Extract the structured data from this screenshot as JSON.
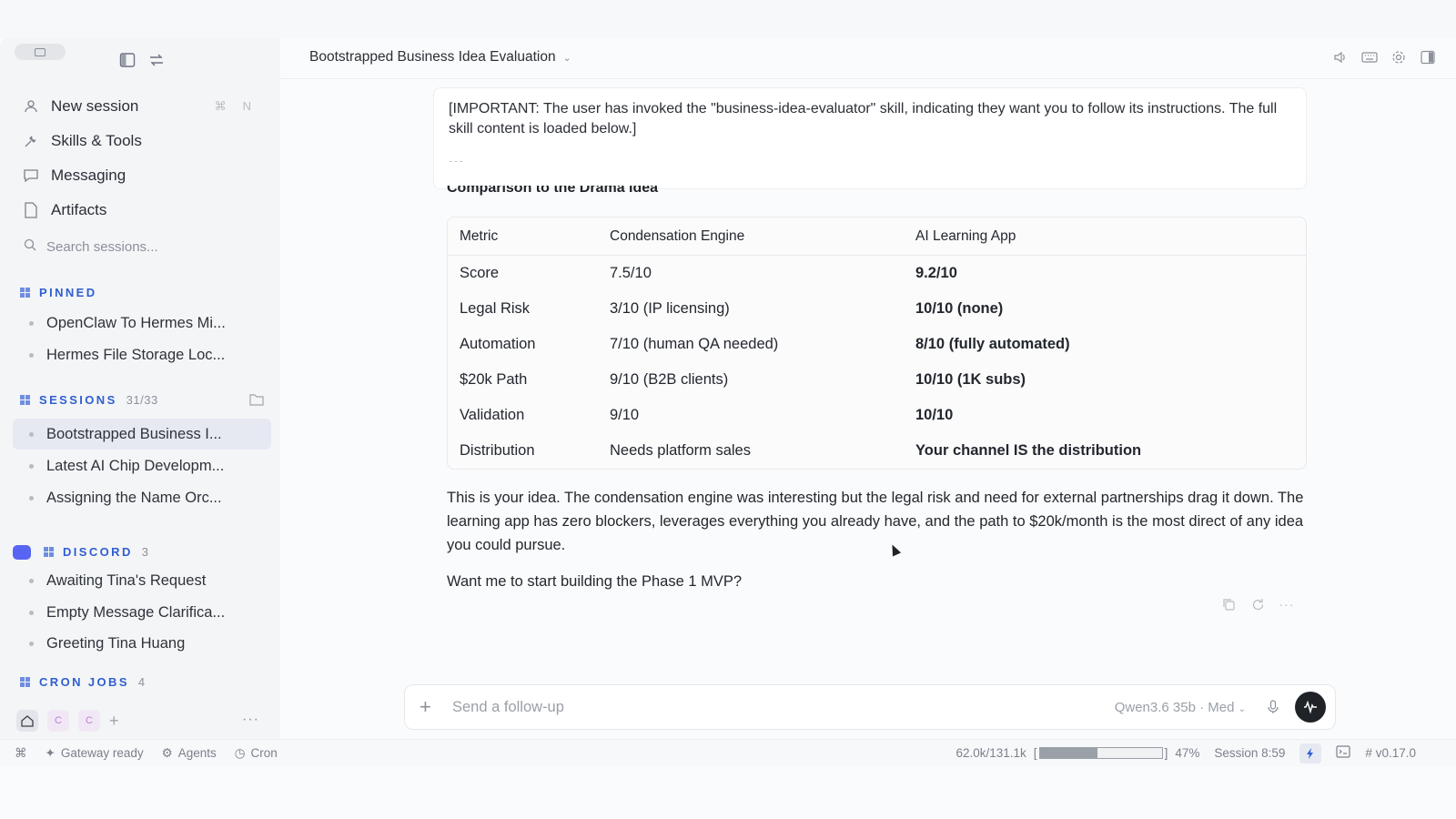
{
  "header": {
    "title": "Bootstrapped Business Idea Evaluation"
  },
  "sidebar": {
    "nav": [
      {
        "label": "New session",
        "icon": "user-plus-icon",
        "shortcut": [
          "⌘",
          "N"
        ]
      },
      {
        "label": "Skills & Tools",
        "icon": "tools-icon"
      },
      {
        "label": "Messaging",
        "icon": "chat-icon"
      },
      {
        "label": "Artifacts",
        "icon": "document-icon"
      }
    ],
    "search_placeholder": "Search sessions...",
    "pinned": {
      "label": "PINNED",
      "items": [
        "OpenClaw To Hermes Mi...",
        "Hermes File Storage Loc..."
      ]
    },
    "sessions": {
      "label": "SESSIONS",
      "count": "31/33",
      "items": [
        "Bootstrapped Business I...",
        "Latest AI Chip Developm...",
        "Assigning the Name Orc..."
      ]
    },
    "discord": {
      "label": "DISCORD",
      "count": "3",
      "items": [
        "Awaiting Tina's Request",
        "Empty Message Clarifica...",
        "Greeting Tina Huang"
      ]
    },
    "cron": {
      "label": "CRON JOBS",
      "count": "4"
    },
    "tabs": [
      "C",
      "C"
    ]
  },
  "main": {
    "prompt_text": "[IMPORTANT: The user has invoked the \"business-idea-evaluator\" skill, indicating they want you to follow its instructions. The full skill content is loaded below.]",
    "prompt_rule": "---",
    "partial_heading": "Comparison to the Drama Idea",
    "table": {
      "headers": [
        "Metric",
        "Condensation Engine",
        "AI Learning App"
      ],
      "rows": [
        [
          "Score",
          "7.5/10",
          "9.2/10"
        ],
        [
          "Legal Risk",
          "3/10 (IP licensing)",
          "10/10 (none)"
        ],
        [
          "Automation",
          "7/10 (human QA needed)",
          "8/10 (fully automated)"
        ],
        [
          "$20k Path",
          "9/10 (B2B clients)",
          "10/10 (1K subs)"
        ],
        [
          "Validation",
          "9/10",
          "10/10"
        ],
        [
          "Distribution",
          "Needs platform sales",
          "Your channel IS the distribution"
        ]
      ]
    },
    "paragraph": "This is your idea. The condensation engine was interesting but the legal risk and need for external partnerships drag it down. The learning app has zero blockers, leverages everything you already have, and the path to $20k/month is the most direct of any idea you could pursue.",
    "question": "Want me to start building the Phase 1 MVP?"
  },
  "composer": {
    "placeholder": "Send a follow-up",
    "model": "Qwen3.6 35b · Med"
  },
  "status": {
    "gateway": "Gateway ready",
    "agents": "Agents",
    "cron": "Cron",
    "tokens": "62.0k/131.1k",
    "percent": "47%",
    "percent_value": 47,
    "session": "Session 8:59",
    "version": "v0.17.0"
  },
  "colors": {
    "accent": "#2f5fd0",
    "discord": "#5865f2",
    "send_button": "#1f2328"
  }
}
